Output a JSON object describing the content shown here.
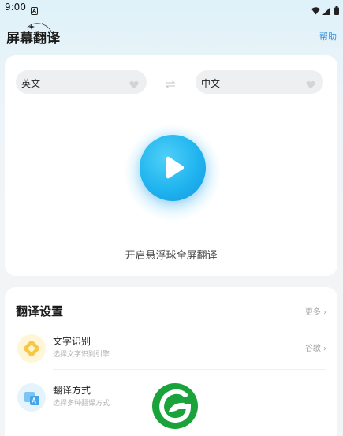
{
  "status_bar": {
    "time": "9:00"
  },
  "app_bar": {
    "title": "屏幕翻译",
    "help_label": "帮助"
  },
  "translator": {
    "source_language": "英文",
    "target_language": "中文",
    "float_caption": "开启悬浮球全屏翻译"
  },
  "settings": {
    "title": "翻译设置",
    "more_label": "更多",
    "items": [
      {
        "title": "文字识别",
        "subtitle": "选择文字识别引擎",
        "value": "谷歌"
      },
      {
        "title": "翻译方式",
        "subtitle": "选择多种翻译方式",
        "value": ""
      }
    ]
  },
  "colors": {
    "accent": "#20b4ef",
    "help_link": "#2f8fdb",
    "logo_green": "#1aa33a"
  }
}
